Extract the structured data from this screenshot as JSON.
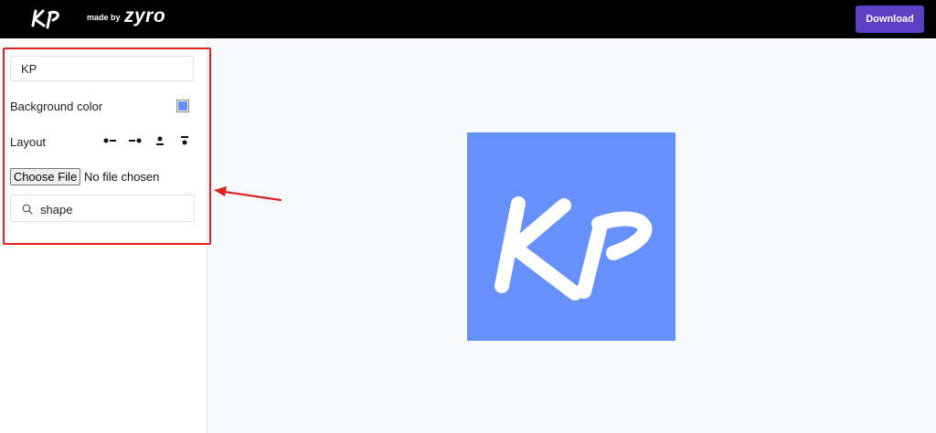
{
  "header": {
    "logo_text": "KP",
    "made_by": "made by",
    "brand": "zyro",
    "download_label": "Download"
  },
  "sidebar": {
    "name_value": "KP",
    "background_color_label": "Background color",
    "background_color": "#6690fc",
    "layout_label": "Layout",
    "layout_options": [
      "icon-left",
      "icon-right",
      "icon-top",
      "icon-bottom"
    ],
    "choose_file_label": "Choose File",
    "file_status": "No file chosen",
    "search_value": "shape"
  },
  "preview": {
    "text": "KP",
    "background_color": "#6690fc",
    "text_color": "#ffffff"
  },
  "colors": {
    "accent": "#5b3fc4",
    "annotation": "#e02020"
  }
}
